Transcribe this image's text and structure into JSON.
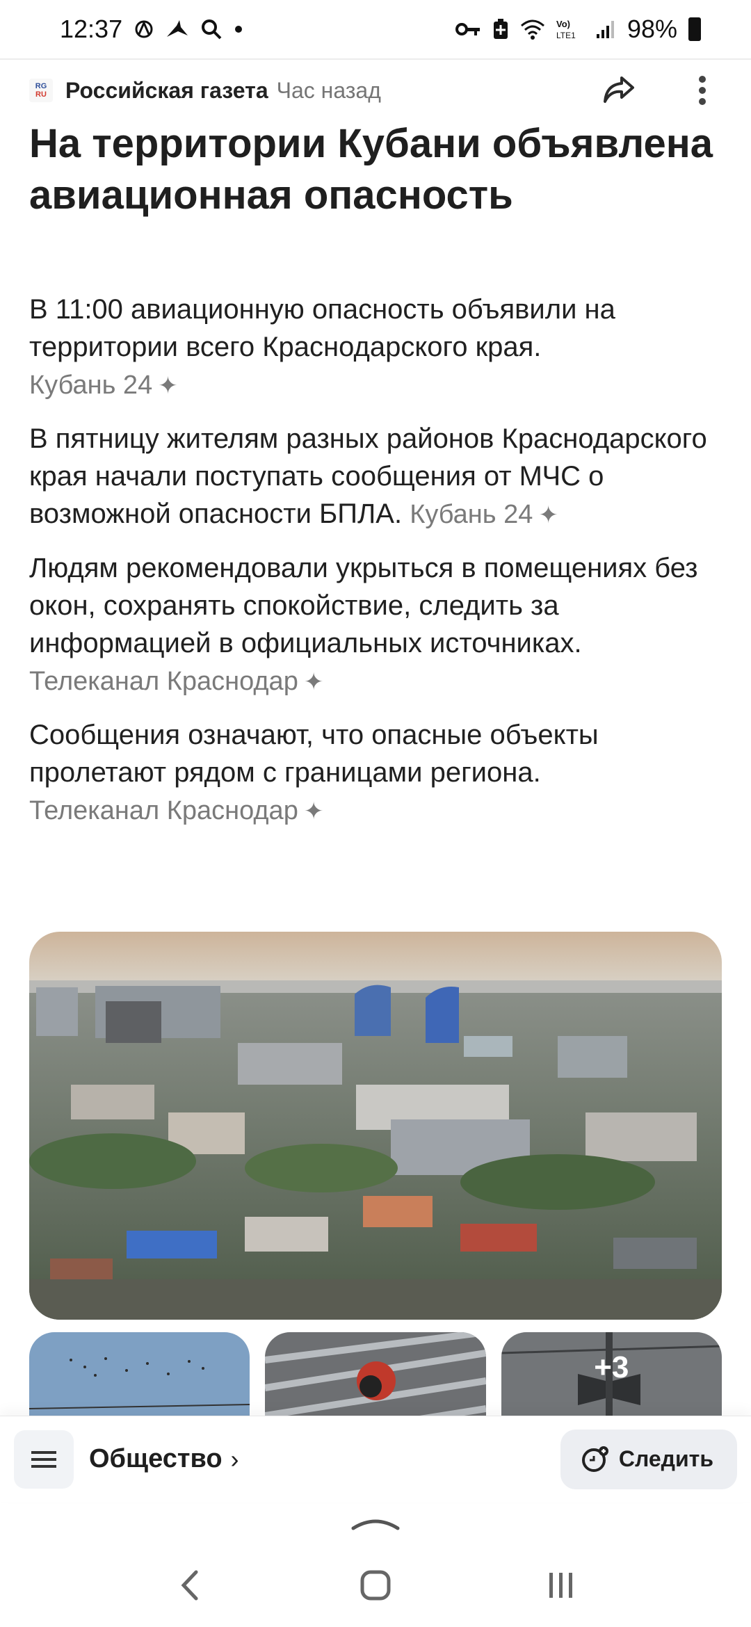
{
  "status_bar": {
    "time": "12:37",
    "battery": "98%",
    "icons": [
      "threads-icon",
      "bird-icon",
      "search-icon",
      "dot-icon",
      "key-icon",
      "battery-saver-icon",
      "wifi-icon",
      "volte-icon",
      "signal-icon",
      "battery-icon"
    ]
  },
  "article": {
    "source_name": "Российская газета",
    "time_ago": "Час назад",
    "title": "На территории Кубани объявлена авиационная опасность",
    "paragraphs": [
      {
        "text": "В 11:00 авиационную опасность объявили на территории всего Краснодарского края.",
        "source": "Кубань 24"
      },
      {
        "text": "В пятницу жителям разных районов Краснодарского края начали поступать сообщения от МЧС о возможной опасности БПЛА.",
        "source": "Кубань 24"
      },
      {
        "text": "Людям рекомендовали укрыться в помещениях без окон, сохранять спокойствие, следить за информацией в официальных источниках.",
        "source": "Телеканал Краснодар"
      },
      {
        "text": "Сообщения означают, что опасные объекты пролетают рядом с границами региона.",
        "source": "Телеканал Краснодар"
      }
    ],
    "more_images": "+3"
  },
  "topic_bar": {
    "topic": "Общество",
    "follow_label": "Следить"
  },
  "colors": {
    "text": "#1f1f1f",
    "muted": "#757575",
    "chip_bg": "#eceef2"
  }
}
